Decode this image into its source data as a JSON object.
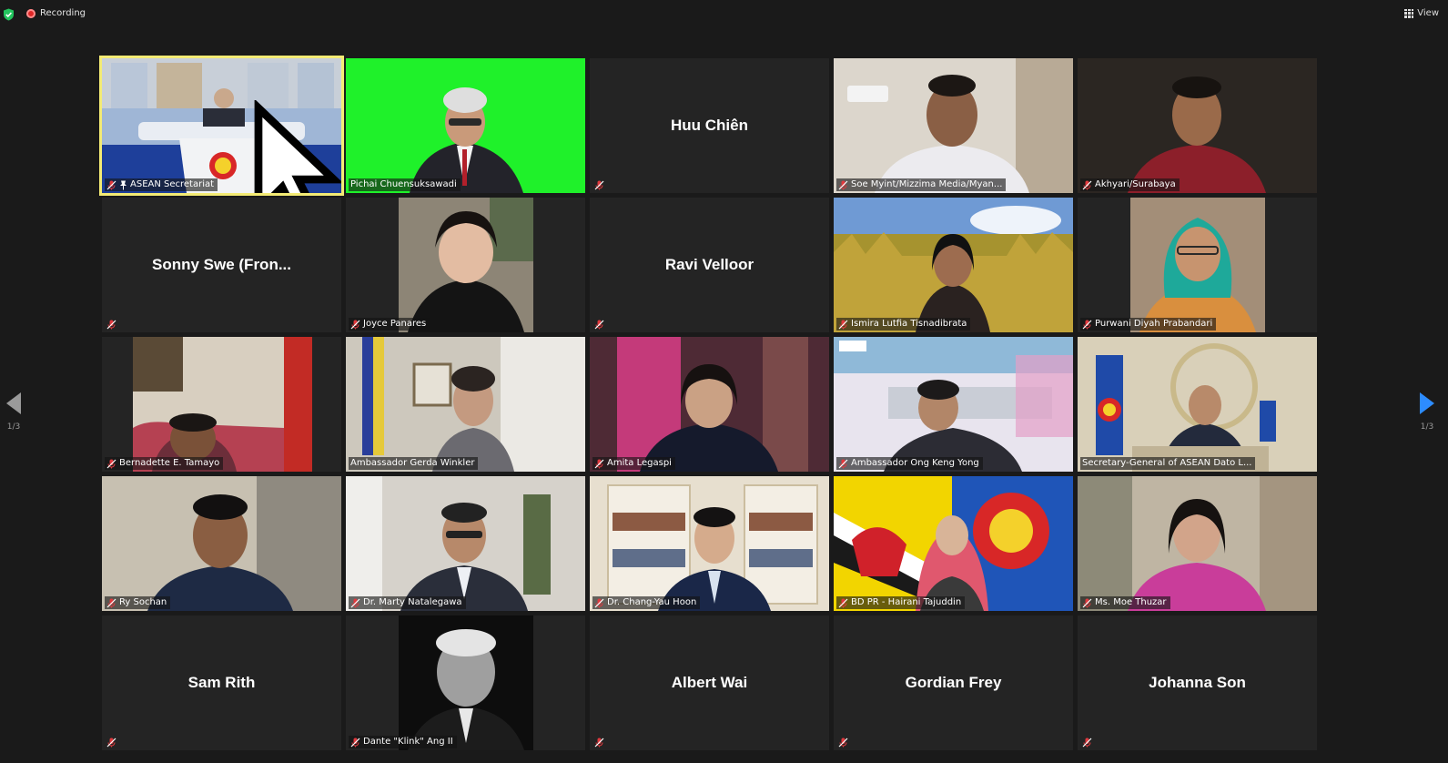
{
  "topbar": {
    "recording_label": "Recording",
    "view_label": "View"
  },
  "pagination": {
    "left": "1/3",
    "right": "1/3"
  },
  "tiles": [
    {
      "name": "ASEAN Secretariat"
    },
    {
      "name": "Pichai Chuensuksawadi"
    },
    {
      "name": "Huu Chiên"
    },
    {
      "name": "Soe Myint/Mizzima Media/Myan..."
    },
    {
      "name": "Akhyari/Surabaya"
    },
    {
      "name": "Sonny Swe  (Fron..."
    },
    {
      "name": "Joyce Panares"
    },
    {
      "name": "Ravi Velloor"
    },
    {
      "name": "Ismira Lutfia Tisnadibrata"
    },
    {
      "name": "Purwani Diyah Prabandari"
    },
    {
      "name": "Bernadette E. Tamayo"
    },
    {
      "name": "Ambassador Gerda Winkler"
    },
    {
      "name": "Amita Legaspi"
    },
    {
      "name": "Ambassador Ong Keng Yong"
    },
    {
      "name": "Secretary-General of ASEAN Dato L..."
    },
    {
      "name": "Ry Sochan"
    },
    {
      "name": "Dr. Marty Natalegawa"
    },
    {
      "name": "Dr. Chang-Yau Hoon"
    },
    {
      "name": "BD PR - Hairani Tajuddin"
    },
    {
      "name": "Ms. Moe Thuzar"
    },
    {
      "name": "Sam Rith"
    },
    {
      "name": "Dante \"Klink\" Ang II"
    },
    {
      "name": "Albert Wai"
    },
    {
      "name": "Gordian Frey"
    },
    {
      "name": "Johanna Son"
    }
  ],
  "icons": {
    "security": "shield-check-icon",
    "recording": "record-dot-icon",
    "view": "grid-view-icon",
    "muted": "mic-muted-icon",
    "pinned": "pin-icon",
    "prev": "arrow-left-icon",
    "next": "arrow-right-icon"
  },
  "colors": {
    "background": "#1a1a1a",
    "tile": "#242424",
    "active_speaker_border": "#f4eb74",
    "accent": "#2d8cff",
    "recording": "#e02828",
    "muted": "#e0393e",
    "security": "#23c55e"
  }
}
